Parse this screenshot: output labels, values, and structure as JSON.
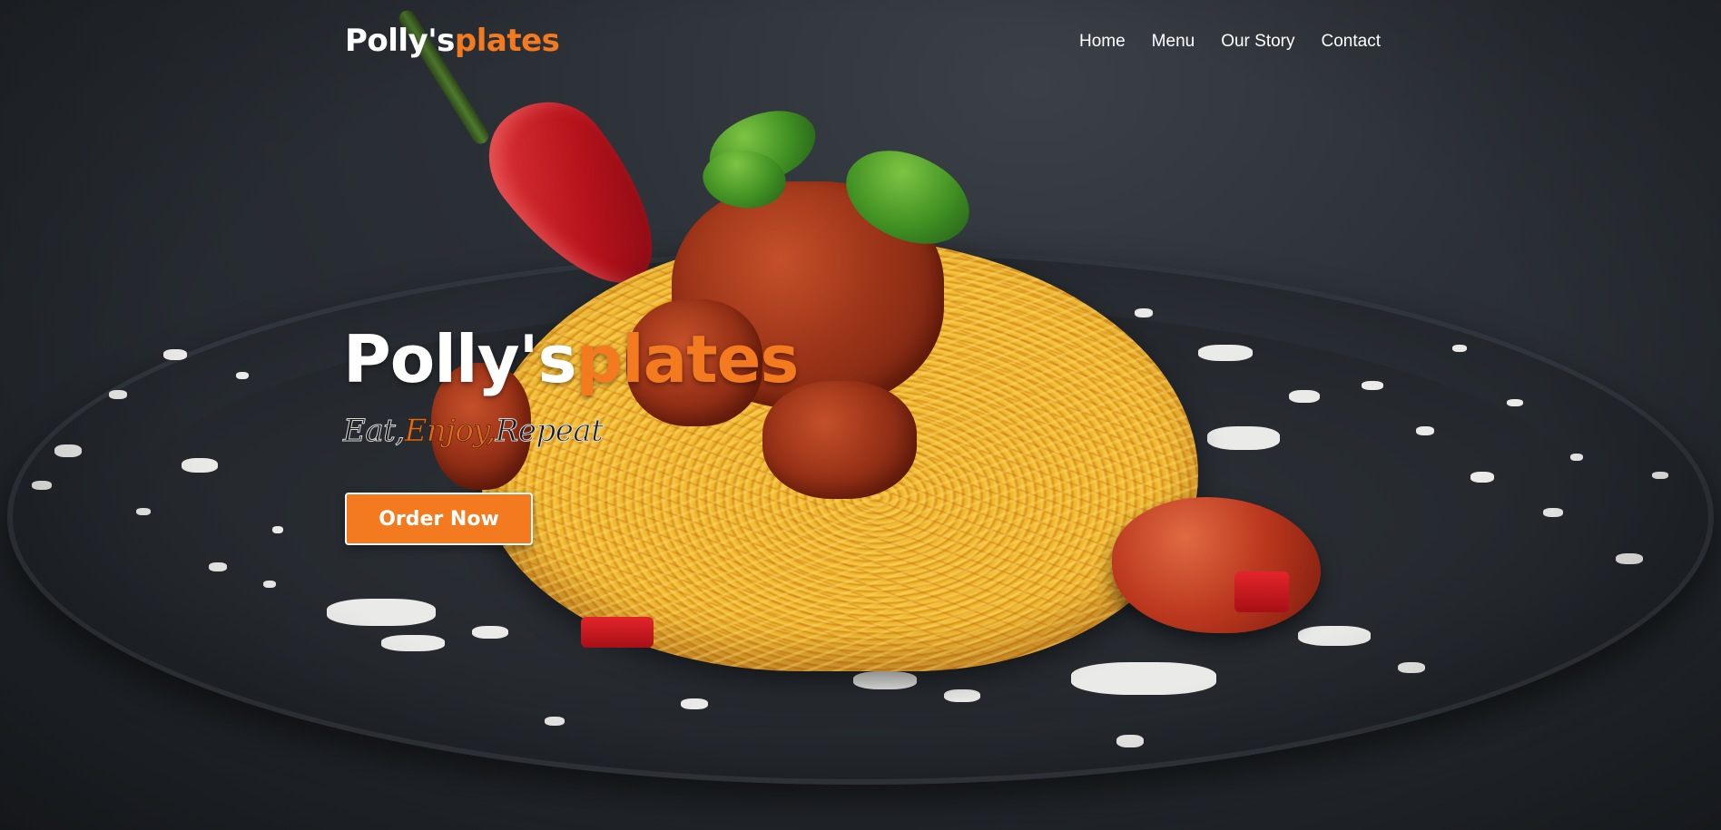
{
  "brand": {
    "name_part1": "Polly's",
    "name_part2": "plates"
  },
  "nav": {
    "items": [
      {
        "label": "Home"
      },
      {
        "label": "Menu"
      },
      {
        "label": "Our Story"
      },
      {
        "label": "Contact"
      }
    ]
  },
  "hero": {
    "title_part1": "Polly's",
    "title_part2": "plates",
    "tagline": {
      "word1": "Eat,",
      "word2": "Enjoy,",
      "word3": "Repeat"
    },
    "cta_label": "Order Now",
    "background_image": "spaghetti-plate-image"
  },
  "colors": {
    "accent": "#f47a1f",
    "text": "#ffffff",
    "background": "#23272c"
  }
}
